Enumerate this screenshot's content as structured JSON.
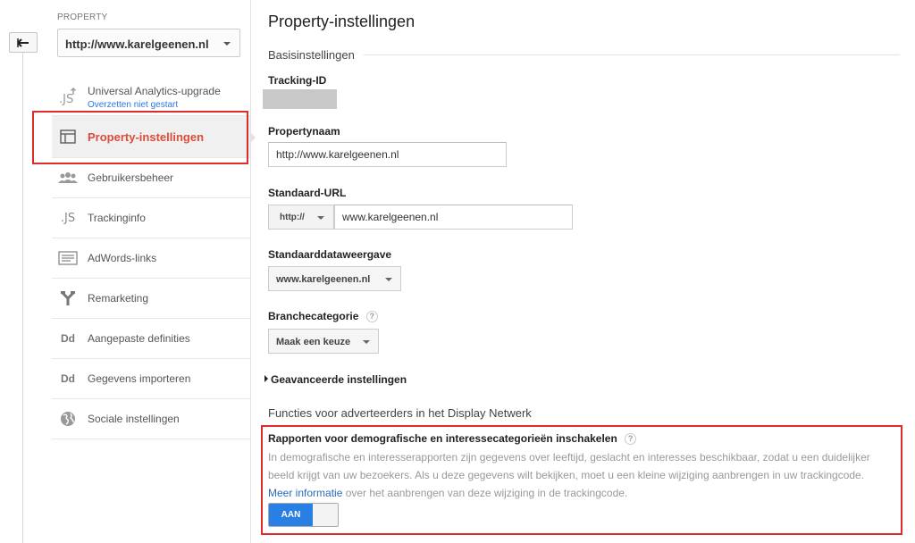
{
  "sidebar": {
    "property_label": "PROPERTY",
    "property_value": "http://www.karelgeenen.nl",
    "items": [
      {
        "label": "Universal Analytics-upgrade",
        "sub": "Overzetten niet gestart",
        "icon": "js-upgrade-icon"
      },
      {
        "label": "Property-instellingen",
        "icon": "property-settings-icon",
        "active": true
      },
      {
        "label": "Gebruikersbeheer",
        "icon": "users-icon"
      },
      {
        "label": "Trackinginfo",
        "icon": "js-icon"
      },
      {
        "label": "AdWords-links",
        "icon": "adwords-icon"
      },
      {
        "label": "Remarketing",
        "icon": "remarketing-icon"
      },
      {
        "label": "Aangepaste definities",
        "icon": "dd-icon"
      },
      {
        "label": "Gegevens importeren",
        "icon": "dd-icon"
      },
      {
        "label": "Sociale instellingen",
        "icon": "globe-icon"
      }
    ]
  },
  "icon_text": {
    "js": ".JS",
    "dd": "Dd"
  },
  "main": {
    "title": "Property-instellingen",
    "basic_heading": "Basisinstellingen",
    "tracking_id_label": "Tracking-ID",
    "property_name_label": "Propertynaam",
    "property_name_value": "http://www.karelgeenen.nl",
    "default_url_label": "Standaard-URL",
    "protocol_value": "http://",
    "default_url_value": "www.karelgeenen.nl",
    "default_view_label": "Standaarddataweergave",
    "default_view_value": "www.karelgeenen.nl",
    "industry_label": "Branchecategorie",
    "industry_value": "Maak een keuze",
    "help_glyph": "?",
    "advanced_label": "Geavanceerde instellingen",
    "display_heading": "Functies voor adverteerders in het Display Netwerk",
    "feature_title": "Rapporten voor demografische en interessecategorieën inschakelen",
    "feature_desc": "In demografische en interesserapporten zijn gegevens over leeftijd, geslacht en interesses beschikbaar, zodat u een duidelijker beeld krijgt van uw bezoekers. Als u deze gegevens wilt bekijken, moet u een kleine wijziging aanbrengen in uw trackingcode.",
    "more_info_link": "Meer informatie",
    "more_info_rest": " over het aanbrengen van deze wijziging in de trackingcode.",
    "toggle_label": "AAN"
  },
  "colors": {
    "accent_red": "#dd4b39",
    "highlight_red": "#e02b2b",
    "toggle_blue": "#2a7fe5",
    "link_blue": "#2a6bb8"
  }
}
